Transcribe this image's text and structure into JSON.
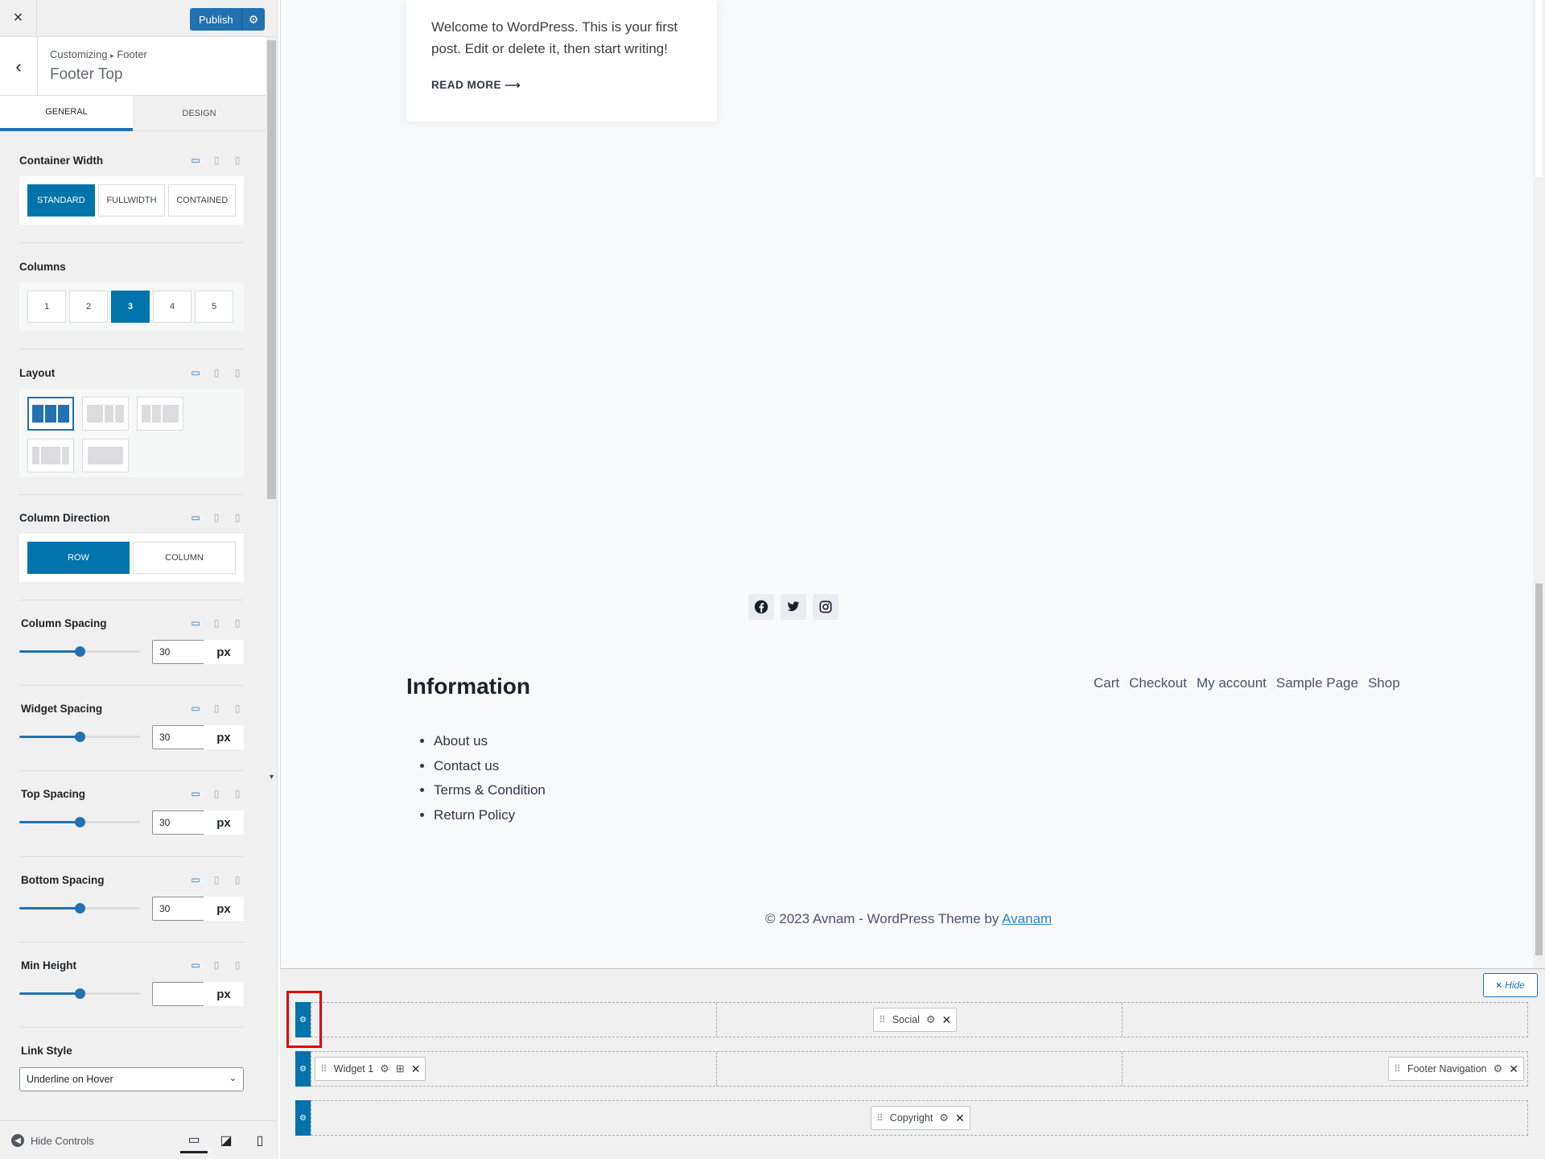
{
  "topbar": {
    "close_glyph": "×",
    "publish_label": "Publish"
  },
  "section": {
    "breadcrumb_root": "Customizing",
    "breadcrumb_sep": "▸",
    "breadcrumb_parent": "Footer",
    "title": "Footer Top"
  },
  "tabs": [
    {
      "label": "General",
      "active": true
    },
    {
      "label": "Design",
      "active": false
    }
  ],
  "controls": {
    "container_width": {
      "label": "Container Width",
      "options": [
        "Standard",
        "Fullwidth",
        "Contained"
      ],
      "selected": "Standard"
    },
    "columns": {
      "label": "Columns",
      "options": [
        "1",
        "2",
        "3",
        "4",
        "5"
      ],
      "selected": "3"
    },
    "layout": {
      "label": "Layout",
      "selected_index": 0
    },
    "column_direction": {
      "label": "Column Direction",
      "options": [
        "Row",
        "Column"
      ],
      "selected": "Row"
    },
    "column_spacing": {
      "label": "Column Spacing",
      "value": "30",
      "unit": "px",
      "level": 0.5
    },
    "widget_spacing": {
      "label": "Widget Spacing",
      "value": "30",
      "unit": "px",
      "level": 0.5
    },
    "top_spacing": {
      "label": "Top Spacing",
      "value": "30",
      "unit": "px",
      "level": 0.5
    },
    "bottom_spacing": {
      "label": "Bottom Spacing",
      "value": "30",
      "unit": "px",
      "level": 0.5
    },
    "min_height": {
      "label": "Min Height",
      "value": "",
      "unit": "px",
      "level": 0.5
    },
    "link_style": {
      "label": "Link Style",
      "value": "Underline on Hover"
    }
  },
  "footer_bar": {
    "hide_label": "Hide Controls"
  },
  "preview": {
    "post_excerpt": "Welcome to WordPress. This is your first post. Edit or delete it, then start writing!",
    "read_more": "READ MORE ⟶",
    "info_title": "Information",
    "info_links": [
      "About us",
      "Contact us",
      "Terms & Condition",
      "Return Policy"
    ],
    "nav_links": [
      "Cart",
      "Checkout",
      "My account",
      "Sample Page",
      "Shop"
    ],
    "copyright_text": "© 2023 Avnam - WordPress Theme by ",
    "copyright_link": "Avanam"
  },
  "builder": {
    "hide_label": "Hide",
    "row1_item": "Social",
    "row2_item_left": "Widget 1",
    "row2_item_right": "Footer Navigation",
    "row3_item": "Copyright"
  },
  "colors": {
    "accent": "#0073aa",
    "highlight": "#e00000"
  }
}
